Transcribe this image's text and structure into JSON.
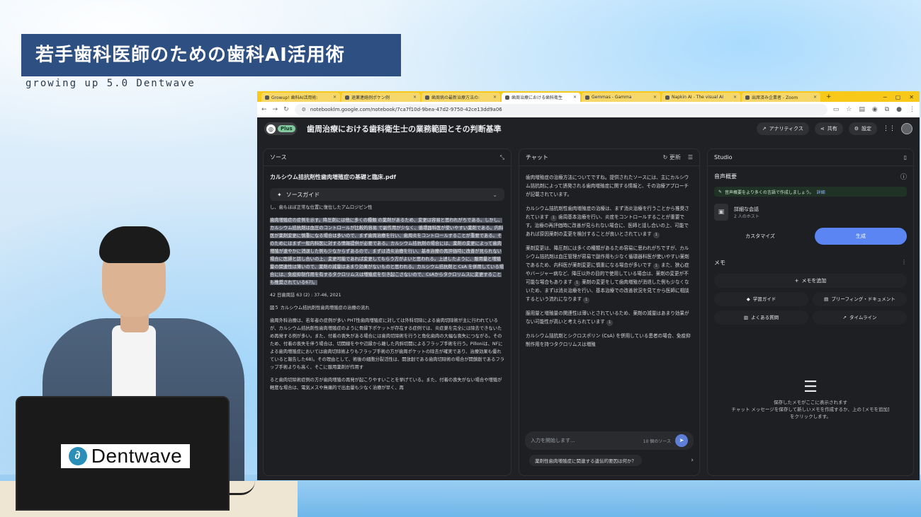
{
  "overlay": {
    "title": "若手歯科医師のための歯科AI活用術",
    "subtitle": "growing up 5.0 Dentwave",
    "laptop_brand": "Dentwave"
  },
  "browser": {
    "tabs": [
      {
        "label": "Growup! 歯科AI活用術:"
      },
      {
        "label": "退薬連絡例ポケン例"
      },
      {
        "label": "歯周病の最新治療方法の:"
      },
      {
        "label": "歯周治療における歯科衛生"
      },
      {
        "label": "Gemmas - Gamma"
      },
      {
        "label": "Napkin AI - The visual AI"
      },
      {
        "label": "出席済み企業者 - Zoom"
      }
    ],
    "url": "notebooklm.google.com/notebook/7ca7f10d-9bea-47d2-9750-42ce13dd9a06"
  },
  "notebook": {
    "plan_badge": "Plus",
    "title": "歯周治療における歯科衛生士の業務範囲とその判断基準",
    "analytics_label": "アナリティクス",
    "share_label": "共有",
    "settings_label": "設定"
  },
  "source_panel": {
    "header": "ソース",
    "file_name": "カルシウム拮抗剤性歯肉増殖症の基礎と臨床.pdf",
    "guide_label": "ソースガイド",
    "pre_text": "し、歯もほぼ正常な位置に復位したアムロジピン性",
    "highlighted_text": "歯肉増殖症の症例を示す。降圧剤には他に多くの種類 の薬剤があるため、変更は容易と思われがちである。しかし、カルシウム拮抗剤は血圧のコントロールが比較的容易 で副作用が少なく、循環器科医が使いやすい薬剤である。内科医が薬剤変更に慎重になる場合は多いので、まず歯周治療を行い、歯周炎をコントロールすることが重要である。そのためにはまず一般内科医に対する情報提供が必要である。カルシウム拮抗剤の場合には、薬剤の変更によって歯肉増殖が速やかに消退した例も少なからずあるので、まずは消炎治療を行い、基本治療の再評価時に改善が見られない場合に医師と話し合いの上、変更可能であれば変更してもらう方がよいと思われる。上述したように、服用量と増殖量の関連性は薄いので、薬剤の減量はあまり効果がないものと思われる。カルシウム拮抗剤と CsA を併用している場合には、免疫抑制作用を有するタクロリムスは増殖症を引き起こさないので、CsAからタクロリムスに変更することも推奨されている67)。",
    "citation": "42 日歯周誌 63 (2) : 37-46, 2021",
    "figure_caption": "図５ カルシウム拮抗剤性歯肉増殖症の治療の流れ",
    "body_1": "歯周外科治療は、若年者の症例が多い PHT性歯肉増殖症に対しては外科切除による歯肉切除術が主に行われているが、カルシウム拮抗剤性歯肉増殖症のように骨縁下ポケットが存在する症例では、炎症巣を完全には除去できないため再発する例が多い。また、付着の喪失がある場合には歯肉切除術を行うと角化歯肉の大幅な喪失につながる。そのため、付着の喪失を伴う場合は、切開線をやや辺縁から離した内斜切開によるフラップ手術を行う。Pilloniは、NFによる歯肉増殖症においては歯肉切除術よりもフラップ手術の方が歯周ポケットの除去が確実であり、治療効果も優れていると報告した68)。その理由として、術後の細胞分裂活性は、開放創である歯肉切除術の場合が開鎖創であるフラップ手術よりも高く、そこに服用薬剤が作用す",
    "body_2": "ると歯肉切除術症例の方が歯肉増殖の再発が起こりやすいことを挙げている。また、付着の喪失がない場合や増殖が軽度な場合は、電気メスや無痛的で出血量も少なく治療が早く、再"
  },
  "chat_panel": {
    "header": "チャット",
    "refresh_label": "更新",
    "paragraphs": [
      {
        "text": "歯肉増殖症の治療方法についてですね。提供されたソースには、主にカルシウム拮抗剤によって誘発される歯肉増殖症に関する情報と、その治療アプローチが記載されています。",
        "cite": ""
      },
      {
        "text": "カルシウム拮抗剤性歯肉増殖症の治療は、まず消炎治療を行うことから推奨されています",
        "cite": "1"
      },
      {
        "text": "歯周基本治療を行い、炎症をコントロールすることが重要です。治療の再評価時に改善が見られない場合に、医師と話し合いの上、可能であれば原因薬剤の変更を検討することが良いとされています",
        "cite": "1"
      },
      {
        "text": "薬剤変更は、降圧剤には多くの種類があるため容易に思われがちですが、カルシウム拮抗剤は血圧管理が容易で副作用も少なく循環器科医が使いやすい薬剤であるため、内科医が薬剤変更に慎重になる場合が多いです",
        "cite": "1"
      },
      {
        "text": "また、狭心症やバージャー病など、降圧以外の目的で使用している場合は、薬剤の変更が不可能な場合もあります",
        "cite": "1"
      },
      {
        "text": "薬剤の変更をして歯肉増殖が消退した例も少なくないため、まずは消炎治療を行い、基本治療での改善状況を見てから医師に相談するという流れになります",
        "cite": "1"
      },
      {
        "text": "服用量と増殖量の関連性は薄いとされているため、薬剤の減量はあまり効果がない可能性が高いと考えられています",
        "cite": "1"
      },
      {
        "text": "カルシウム拮抗剤とシクロスポリン (CsA) を併用している患者の場合、免疫抑制作用を持つタクロリムスは増殖",
        "cite": ""
      }
    ],
    "input_placeholder": "入力を開始します...",
    "source_count": "10 個のソース",
    "suggestion": "薬剤性歯肉増殖症に関連する遺伝的要因は何か？"
  },
  "studio_panel": {
    "header": "Studio",
    "audio_title": "音声概要",
    "banner_text": "音声概要をより多くの言語で作成しましょう。",
    "banner_link": "詳細",
    "deep_dive_title": "詳細な会話",
    "deep_dive_hosts": "2 人のホスト",
    "customize_label": "カスタマイズ",
    "generate_label": "生成",
    "memo_title": "メモ",
    "add_memo_label": "メモを追加",
    "study_guide": "学習ガイド",
    "briefing_doc": "ブリーフィング・ドキュメント",
    "faq": "よくある質問",
    "timeline": "タイムライン",
    "empty_line1": "保存したメモがここに表示されます",
    "empty_line2": "チャット メッセージを保存して新しいメモを作成するか、上の [メモを追加]",
    "empty_line3": "をクリックします。"
  }
}
